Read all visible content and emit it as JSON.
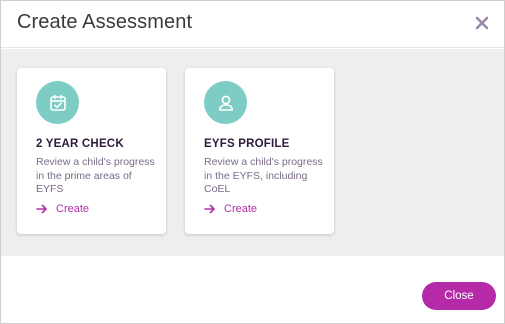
{
  "dialog": {
    "title": "Create Assessment",
    "close_icon": "close-icon"
  },
  "cards": [
    {
      "title": "2 YEAR CHECK",
      "description": "Review a child's progress in the prime areas of EYFS",
      "action_label": "Create",
      "icon": "calendar-check-icon"
    },
    {
      "title": "EYFS PROFILE",
      "description": "Review a child's progress in the EYFS, including CoEL",
      "action_label": "Create",
      "icon": "user-profile-icon"
    }
  ],
  "footer": {
    "close_label": "Close"
  },
  "colors": {
    "accent": "#b52aa8",
    "icon_circle": "#7ecdc4",
    "body_bg": "#eeedf0",
    "close_x": "#9b8aa8"
  }
}
